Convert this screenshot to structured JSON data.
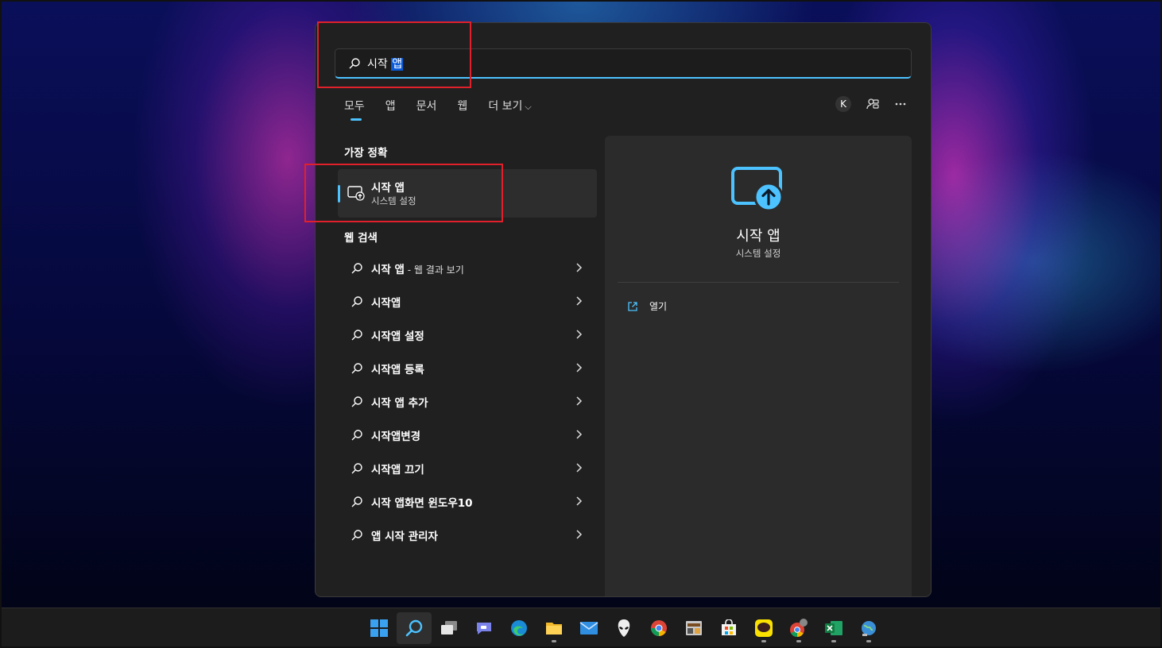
{
  "search": {
    "query_prefix": "시작 ",
    "query_selected": "앱"
  },
  "tabs": [
    {
      "label": "모두",
      "active": true
    },
    {
      "label": "앱"
    },
    {
      "label": "문서"
    },
    {
      "label": "웹"
    },
    {
      "label": "더 보기"
    }
  ],
  "account_initial": "K",
  "best_match": {
    "heading": "가장 정확",
    "title": "시작 앱",
    "subtitle": "시스템 설정"
  },
  "web": {
    "heading": "웹 검색",
    "items": [
      {
        "bold": "시작 앱",
        "rest": " - 웹 결과 보기"
      },
      {
        "bold": "시작앱",
        "rest": ""
      },
      {
        "bold": "시작앱 설정",
        "rest": ""
      },
      {
        "bold": "시작앱 등록",
        "rest": ""
      },
      {
        "bold": "시작 앱 추가",
        "rest": ""
      },
      {
        "bold": "시작앱변경",
        "rest": ""
      },
      {
        "bold": "시작앱 끄기",
        "rest": ""
      },
      {
        "bold": "시작 앱화면 윈도우10",
        "rest": ""
      },
      {
        "bold": "앱 시작 관리자",
        "rest": ""
      }
    ]
  },
  "detail": {
    "title": "시작 앱",
    "subtitle": "시스템 설정",
    "action_open": "열기"
  },
  "colors": {
    "accent": "#4cc2ff",
    "highlight_box": "#e0202a",
    "panel": "#202020"
  },
  "taskbar_icons": [
    "windows-start-icon",
    "search-icon",
    "task-view-icon",
    "chat-icon",
    "edge-icon",
    "file-explorer-icon",
    "mail-icon",
    "alienware-icon",
    "chrome-icon",
    "app-icon",
    "store-icon",
    "kakaotalk-icon",
    "chrome-profile-icon",
    "excel-icon",
    "network-icon"
  ]
}
